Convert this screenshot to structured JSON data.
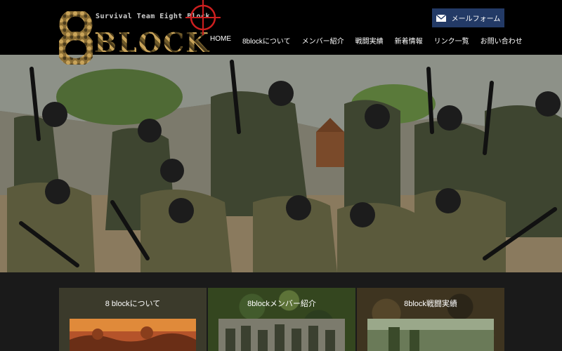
{
  "brand": {
    "logo_number": "8",
    "logo_word": "BLOCK",
    "logo_subtitle": "Survival Team  Eight Block"
  },
  "header": {
    "mail_button_label": "メールフォーム"
  },
  "nav": {
    "items": [
      {
        "label": "HOME"
      },
      {
        "label": "8blockについて"
      },
      {
        "label": "メンバー紹介"
      },
      {
        "label": "戦闘実績"
      },
      {
        "label": "新着情報"
      },
      {
        "label": "リンク一覧"
      },
      {
        "label": "お問い合わせ"
      }
    ]
  },
  "cards": [
    {
      "title": "8 blockについて"
    },
    {
      "title": "8blockメンバー紹介"
    },
    {
      "title": "8block戦闘実績"
    }
  ],
  "colors": {
    "header_bg": "#000000",
    "mail_button_bg": "#233a66",
    "content_bg": "#1a1a1a",
    "crosshair": "#cc1f1f"
  },
  "icons": {
    "mail": "envelope-icon",
    "crosshair": "crosshair-icon"
  }
}
